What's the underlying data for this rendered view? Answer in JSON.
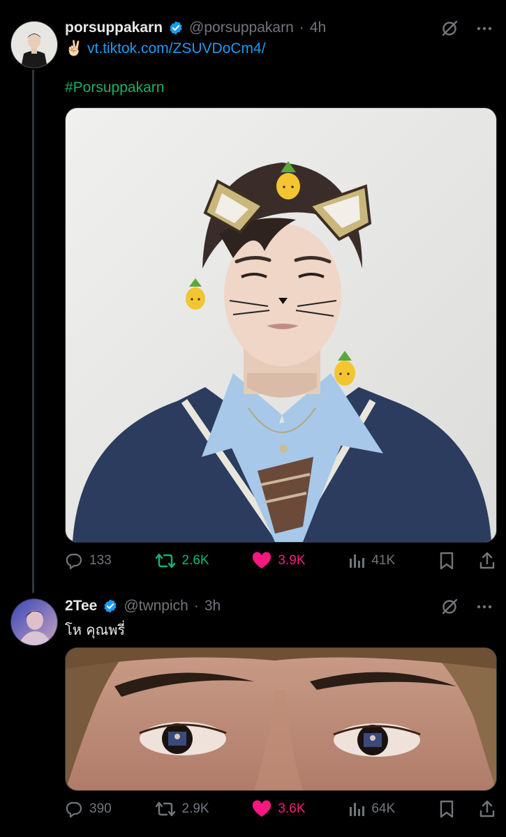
{
  "colors": {
    "background": "#000000",
    "link": "#1d9bf0",
    "hashtag": "#1fae68",
    "retweet_active": "#00ba7c",
    "like_active": "#f91880",
    "muted": "#71767b"
  },
  "post1": {
    "author_name": "porsuppakarn",
    "handle": "@porsuppakarn",
    "separator": "·",
    "time": "4h",
    "emoji": "✌🏻",
    "link_text": "vt.tiktok.com/ZSUVDoCm4/",
    "hashtag": "#Porsuppakarn",
    "media_icons": [
      "pineapple-sticker-icon",
      "cat-ear-filter-icon"
    ],
    "stats": {
      "replies": "133",
      "retweets": "2.6K",
      "likes": "3.9K",
      "views": "41K"
    },
    "retweeted": true,
    "liked": true
  },
  "post2": {
    "author_name": "2Tee",
    "handle": "@twnpich",
    "separator": "·",
    "time": "3h",
    "text": "โห คุณพรี่",
    "stats": {
      "replies": "390",
      "retweets": "2.9K",
      "likes": "3.6K",
      "views": "64K"
    },
    "retweeted": false,
    "liked": true
  }
}
